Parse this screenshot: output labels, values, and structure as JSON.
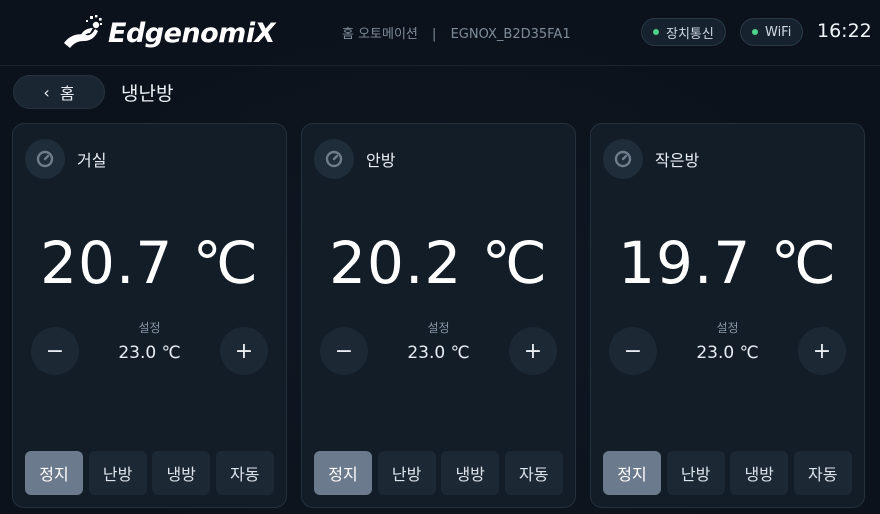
{
  "header": {
    "logo_text": "EdgenomiX",
    "breadcrumb": "홈 오토메이션",
    "separator": "|",
    "device_id": "EGNOX_B2D35FA1",
    "status_device": "장치통신",
    "status_wifi": "WiFi",
    "clock": "16:22",
    "status_color": "#4fd38a"
  },
  "nav": {
    "back_label": "홈",
    "page_title": "냉난방"
  },
  "rooms": [
    {
      "name": "거실",
      "current_temp": "20.7 ℃",
      "set_label": "설정",
      "set_temp": "23.0 ℃",
      "modes": [
        "정지",
        "난방",
        "냉방",
        "자동"
      ],
      "active_mode": "정지"
    },
    {
      "name": "안방",
      "current_temp": "20.2 ℃",
      "set_label": "설정",
      "set_temp": "23.0 ℃",
      "modes": [
        "정지",
        "난방",
        "냉방",
        "자동"
      ],
      "active_mode": "정지"
    },
    {
      "name": "작은방",
      "current_temp": "19.7 ℃",
      "set_label": "설정",
      "set_temp": "23.0 ℃",
      "modes": [
        "정지",
        "난방",
        "냉방",
        "자동"
      ],
      "active_mode": "정지"
    }
  ],
  "controls": {
    "minus_symbol": "−",
    "plus_symbol": "+"
  },
  "icons": {
    "back": "chevron-left-icon",
    "room": "thermostat-icon",
    "logo": "runner-logo-icon"
  },
  "colors": {
    "accent_active_mode": "#6c7a8e",
    "background": "#0b121b",
    "card": "#131d28"
  }
}
